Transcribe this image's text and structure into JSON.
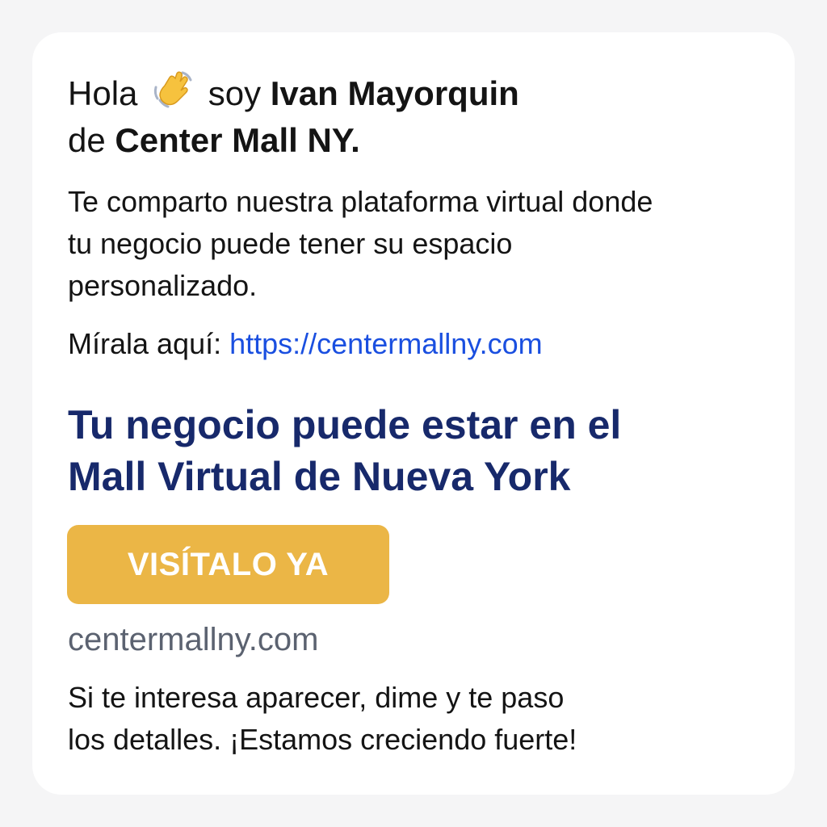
{
  "greeting": {
    "hello": "Hola",
    "wave_icon": "waving-hand-icon",
    "soy": "soy",
    "name": "Ivan Mayorquin",
    "de": "de",
    "company": "Center Mall NY."
  },
  "intro": {
    "line1": "Te comparto nuestra plataforma virtual donde",
    "line2": "tu negocio puede tener su espacio",
    "line3": "personalizado."
  },
  "link_line": {
    "label": "Mírala aquí:",
    "url": "https://centermallny.com"
  },
  "headline": {
    "line1": "Tu negocio puede estar en el",
    "line2": "Mall Virtual de Nueva York"
  },
  "cta": {
    "label": "VISÍTALO YA"
  },
  "domain": "centermallny.com",
  "closing": {
    "line1": "Si te interesa aparecer, dime y te paso",
    "line2": "los detalles. ¡Estamos creciendo fuerte!"
  },
  "colors": {
    "background": "#f5f5f6",
    "card": "#ffffff",
    "link": "#1a4fe0",
    "headline": "#17296b",
    "cta": "#ebb646",
    "domain": "#5b6270"
  }
}
